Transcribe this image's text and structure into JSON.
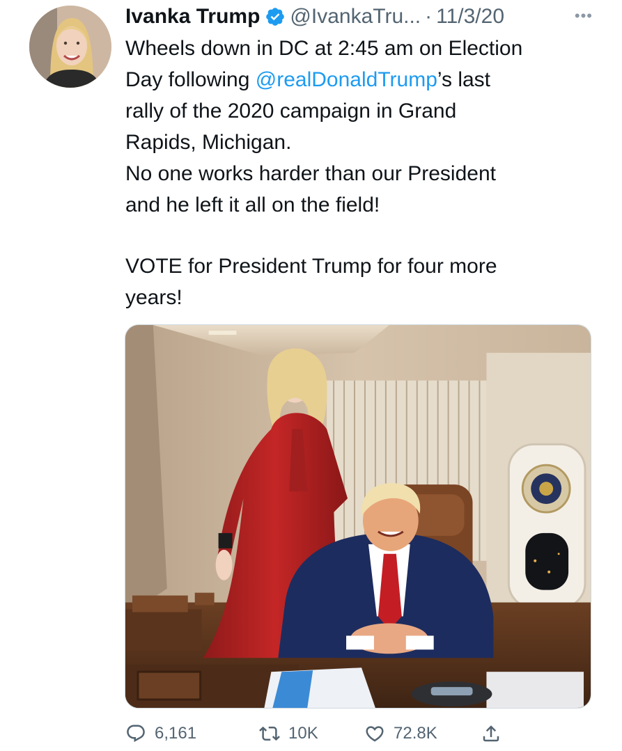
{
  "tweet": {
    "author_name": "Ivanka Trump",
    "handle": "@IvankaTru...",
    "separator": "·",
    "date": "11/3/20",
    "more_label": "•••",
    "text": {
      "line1": "Wheels down in DC at 2:45 am on Election",
      "line2_prefix": "Day following ",
      "mention": "@realDonaldTrump",
      "line2_suffix": "’s last",
      "line3": "rally of the 2020 campaign in Grand",
      "line4": "Rapids, Michigan.",
      "line5": "No one  works harder than our President",
      "line6": "and he left it all on the field!",
      "line7": "VOTE for President Trump for four more",
      "line8": "years!"
    }
  },
  "actions": {
    "reply_count": "6,161",
    "retweet_count": "10K",
    "like_count": "72.8K"
  },
  "icons": {
    "verified": "verified-badge-icon",
    "more": "more-options-icon",
    "reply": "reply-icon",
    "retweet": "retweet-icon",
    "like": "like-heart-icon",
    "share": "share-icon"
  },
  "colors": {
    "text": "#0f1419",
    "secondary": "#536471",
    "accent": "#1d9bf0"
  }
}
